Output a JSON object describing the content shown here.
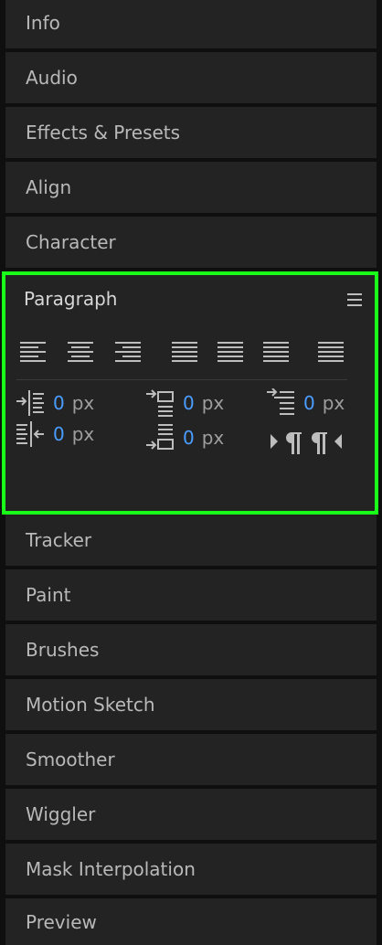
{
  "tabs_above": [
    "Info",
    "Audio",
    "Effects & Presets",
    "Align",
    "Character"
  ],
  "paragraph": {
    "title": "Paragraph",
    "menu_icon": "hamburger-menu-icon",
    "alignment_buttons": [
      "align-left-icon",
      "align-center-icon",
      "align-right-icon",
      "justify-last-left-icon",
      "justify-last-center-icon",
      "justify-last-right-icon",
      "justify-all-icon"
    ],
    "indent_left": {
      "value": "0",
      "unit": "px"
    },
    "space_before": {
      "value": "0",
      "unit": "px"
    },
    "first_line_indent": {
      "value": "0",
      "unit": "px"
    },
    "indent_right": {
      "value": "0",
      "unit": "px"
    },
    "space_after": {
      "value": "0",
      "unit": "px"
    },
    "direction_buttons": [
      "left-to-right-icon",
      "right-to-left-icon"
    ]
  },
  "tabs_below": [
    "Tracker",
    "Paint",
    "Brushes",
    "Motion Sketch",
    "Smoother",
    "Wiggler",
    "Mask Interpolation",
    "Preview"
  ],
  "colors": {
    "highlight": "#1aff1a",
    "value": "#4a9dff",
    "panel": "#232323"
  }
}
